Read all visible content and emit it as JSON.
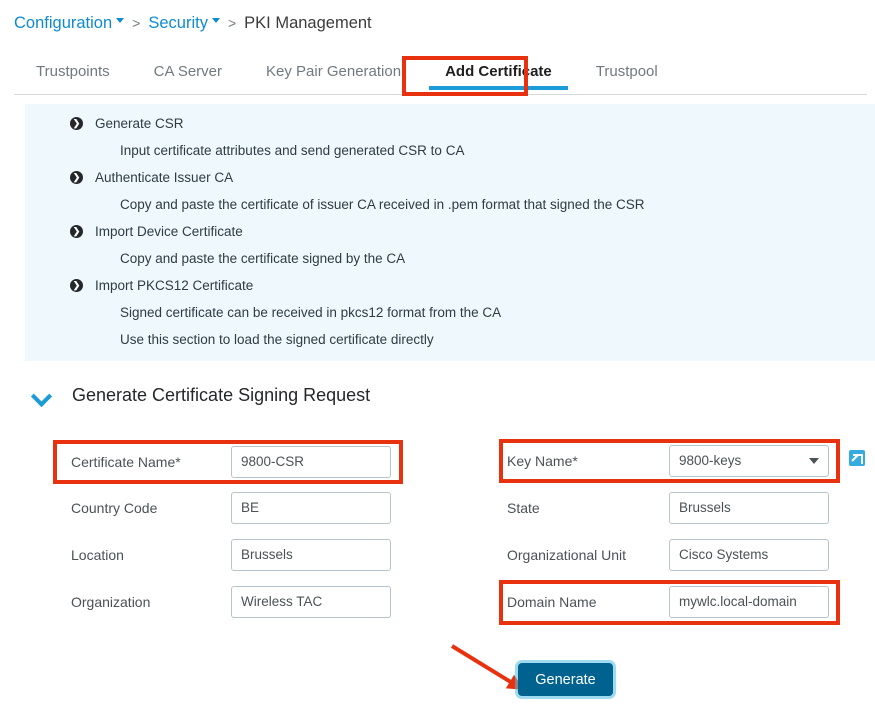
{
  "breadcrumb": {
    "items": [
      {
        "label": "Configuration",
        "type": "dropdown-link"
      },
      {
        "label": "Security",
        "type": "dropdown-link"
      },
      {
        "label": "PKI Management",
        "type": "current"
      }
    ],
    "separator": ">"
  },
  "tabs": [
    {
      "label": "Trustpoints",
      "active": false
    },
    {
      "label": "CA Server",
      "active": false
    },
    {
      "label": "Key Pair Generation",
      "active": false
    },
    {
      "label": "Add Certificate",
      "active": true
    },
    {
      "label": "Trustpool",
      "active": false
    }
  ],
  "info_panel": {
    "bullet_glyph": "❯",
    "entries": [
      {
        "kind": "head",
        "text": "Generate CSR"
      },
      {
        "kind": "sub",
        "text": "Input certificate attributes and send generated CSR to CA"
      },
      {
        "kind": "head",
        "text": "Authenticate Issuer CA"
      },
      {
        "kind": "sub",
        "text": "Copy and paste the certificate of issuer CA received in .pem format that signed the CSR"
      },
      {
        "kind": "head",
        "text": "Import Device Certificate"
      },
      {
        "kind": "sub",
        "text": "Copy and paste the certificate signed by the CA"
      },
      {
        "kind": "head",
        "text": "Import PKCS12 Certificate"
      },
      {
        "kind": "sub",
        "text": "Signed certificate can be received in pkcs12 format from the CA"
      },
      {
        "kind": "sub",
        "text": "Use this section to load the signed certificate directly"
      }
    ]
  },
  "section": {
    "title": "Generate Certificate Signing Request",
    "expanded": true
  },
  "form": {
    "left_column": [
      {
        "label": "Certificate Name*",
        "value": "9800-CSR",
        "control": "text",
        "highlighted": true
      },
      {
        "label": "Country Code",
        "value": "BE",
        "control": "text",
        "highlighted": false
      },
      {
        "label": "Location",
        "value": "Brussels",
        "control": "text",
        "highlighted": false
      },
      {
        "label": "Organization",
        "value": "Wireless TAC",
        "control": "text",
        "highlighted": false
      }
    ],
    "right_column": [
      {
        "label": "Key Name*",
        "value": "9800-keys",
        "control": "select",
        "highlighted": true
      },
      {
        "label": "State",
        "value": "Brussels",
        "control": "text",
        "highlighted": false
      },
      {
        "label": "Organizational Unit",
        "value": "Cisco Systems",
        "control": "text",
        "highlighted": false
      },
      {
        "label": "Domain Name",
        "value": "mywlc.local-domain",
        "control": "text",
        "highlighted": true
      }
    ],
    "key_name_external_link_icon": "external-link-icon"
  },
  "actions": {
    "generate_label": "Generate"
  },
  "colors": {
    "link_blue": "#0d8bd1",
    "tab_accent": "#1b9bd8",
    "info_panel_bg": "#eff8fc",
    "annotation_red": "#e8320f",
    "button_blue": "#00628f",
    "icon_blue": "#35ace0"
  }
}
